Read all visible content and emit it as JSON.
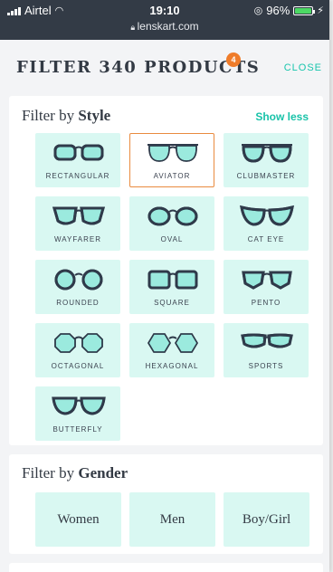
{
  "status_bar": {
    "carrier": "Airtel",
    "time": "19:10",
    "url": "lenskart.com",
    "battery": "96%",
    "battery_level": 0.96
  },
  "header": {
    "title": "FILTER 340 PRODUCTS",
    "badge_count": "4",
    "close_label": "CLOSE"
  },
  "style_filter": {
    "title_prefix": "Filter by",
    "title_bold": "Style",
    "toggle_label": "Show less",
    "selected": "AVIATOR",
    "options": [
      {
        "label": "RECTANGULAR",
        "icon": "rectangular-glasses-icon"
      },
      {
        "label": "AVIATOR",
        "icon": "aviator-glasses-icon"
      },
      {
        "label": "CLUBMASTER",
        "icon": "clubmaster-glasses-icon"
      },
      {
        "label": "WAYFARER",
        "icon": "wayfarer-glasses-icon"
      },
      {
        "label": "OVAL",
        "icon": "oval-glasses-icon"
      },
      {
        "label": "CAT EYE",
        "icon": "cat-eye-glasses-icon"
      },
      {
        "label": "ROUNDED",
        "icon": "rounded-glasses-icon"
      },
      {
        "label": "SQUARE",
        "icon": "square-glasses-icon"
      },
      {
        "label": "PENTO",
        "icon": "pento-glasses-icon"
      },
      {
        "label": "OCTAGONAL",
        "icon": "octagonal-glasses-icon"
      },
      {
        "label": "HEXAGONAL",
        "icon": "hexagonal-glasses-icon"
      },
      {
        "label": "SPORTS",
        "icon": "sports-glasses-icon"
      },
      {
        "label": "BUTTERFLY",
        "icon": "butterfly-glasses-icon"
      }
    ]
  },
  "gender_filter": {
    "title_prefix": "Filter by",
    "title_bold": "Gender",
    "options": [
      {
        "label": "Women"
      },
      {
        "label": "Men"
      },
      {
        "label": "Boy/Girl"
      }
    ]
  },
  "colors": {
    "accent": "#19c3a9",
    "tile_bg": "#d9f8f2",
    "selected_border": "#e98b3f",
    "badge": "#ef7c2a",
    "frame": "#2f3a4a"
  }
}
